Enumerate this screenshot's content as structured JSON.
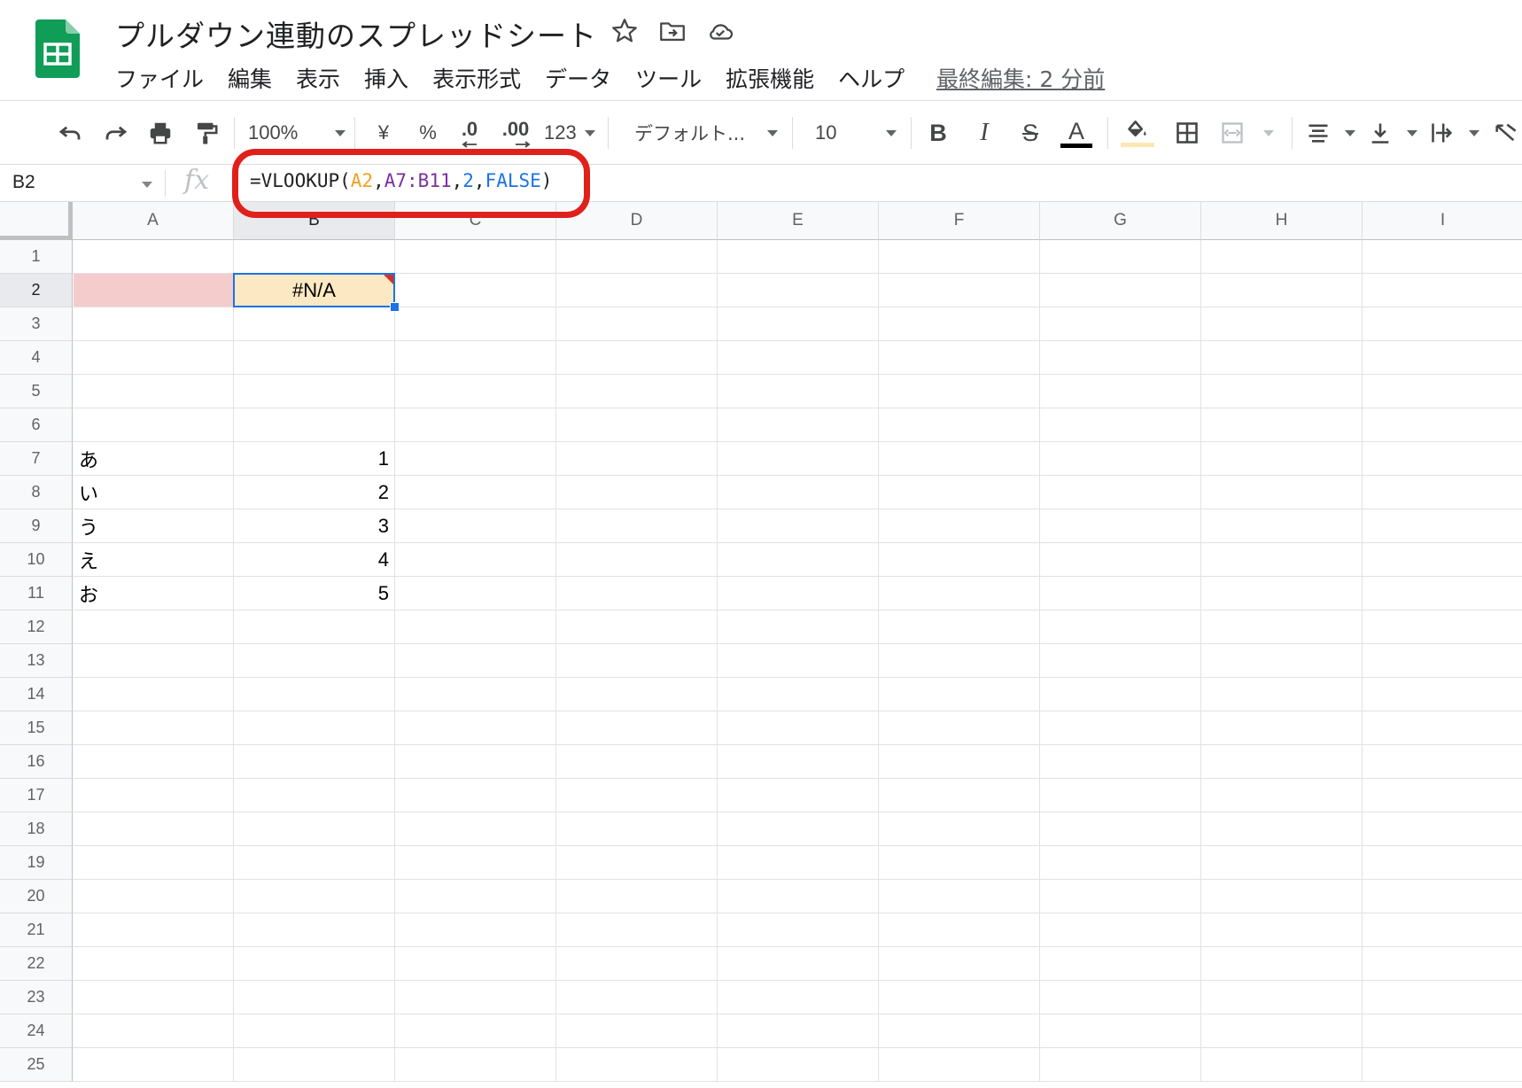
{
  "app": {
    "title": "プルダウン連動のスプレッドシート",
    "last_edit": "最終編集: 2 分前",
    "brand_color": "#0f9d58"
  },
  "menu": [
    "ファイル",
    "編集",
    "表示",
    "挿入",
    "表示形式",
    "データ",
    "ツール",
    "拡張機能",
    "ヘルプ"
  ],
  "title_icons": [
    "star-icon",
    "move-to-folder-icon",
    "cloud-status-icon"
  ],
  "toolbar": {
    "zoom": "100%",
    "currency": "¥",
    "percent": "%",
    "decrease_decimal": ".0",
    "increase_decimal": ".00",
    "more_formats": "123",
    "font": "デフォルト...",
    "font_size": "10",
    "bold": "B",
    "italic": "I",
    "strikethrough": "S",
    "text_color_letter": "A",
    "text_color": "#000000",
    "fill_color": "#fce8b2"
  },
  "formula_bar": {
    "cell_ref": "B2",
    "fx": "fx",
    "formula_parts": [
      {
        "text": "=VLOOKUP(",
        "color": "#202124"
      },
      {
        "text": "A2",
        "color": "#f4a023"
      },
      {
        "text": ",",
        "color": "#202124"
      },
      {
        "text": "A7:B11",
        "color": "#7b2fa2"
      },
      {
        "text": ",",
        "color": "#202124"
      },
      {
        "text": "2",
        "color": "#1a73e8"
      },
      {
        "text": ",",
        "color": "#202124"
      },
      {
        "text": "FALSE",
        "color": "#1a73e8"
      },
      {
        "text": ")",
        "color": "#202124"
      }
    ],
    "highlight_color": "#e0201b"
  },
  "sheet": {
    "columns": [
      "A",
      "B",
      "C",
      "D",
      "E",
      "F",
      "G",
      "H",
      "I"
    ],
    "rows": [
      "1",
      "2",
      "3",
      "4",
      "5",
      "6",
      "7",
      "8",
      "9",
      "10",
      "11",
      "12",
      "13",
      "14",
      "15",
      "16",
      "17",
      "18",
      "19",
      "20",
      "21",
      "22",
      "23",
      "24",
      "25"
    ],
    "selected_column": "B",
    "selected_row": "2",
    "active_cell_value": "#N/A",
    "a2_fill": "#f4cccc",
    "b2_fill": "#fce8c2",
    "data_rows": [
      {
        "row": "7",
        "key": "あ",
        "value": "1"
      },
      {
        "row": "8",
        "key": "い",
        "value": "2"
      },
      {
        "row": "9",
        "key": "う",
        "value": "3"
      },
      {
        "row": "10",
        "key": "え",
        "value": "4"
      },
      {
        "row": "11",
        "key": "お",
        "value": "5"
      }
    ]
  }
}
